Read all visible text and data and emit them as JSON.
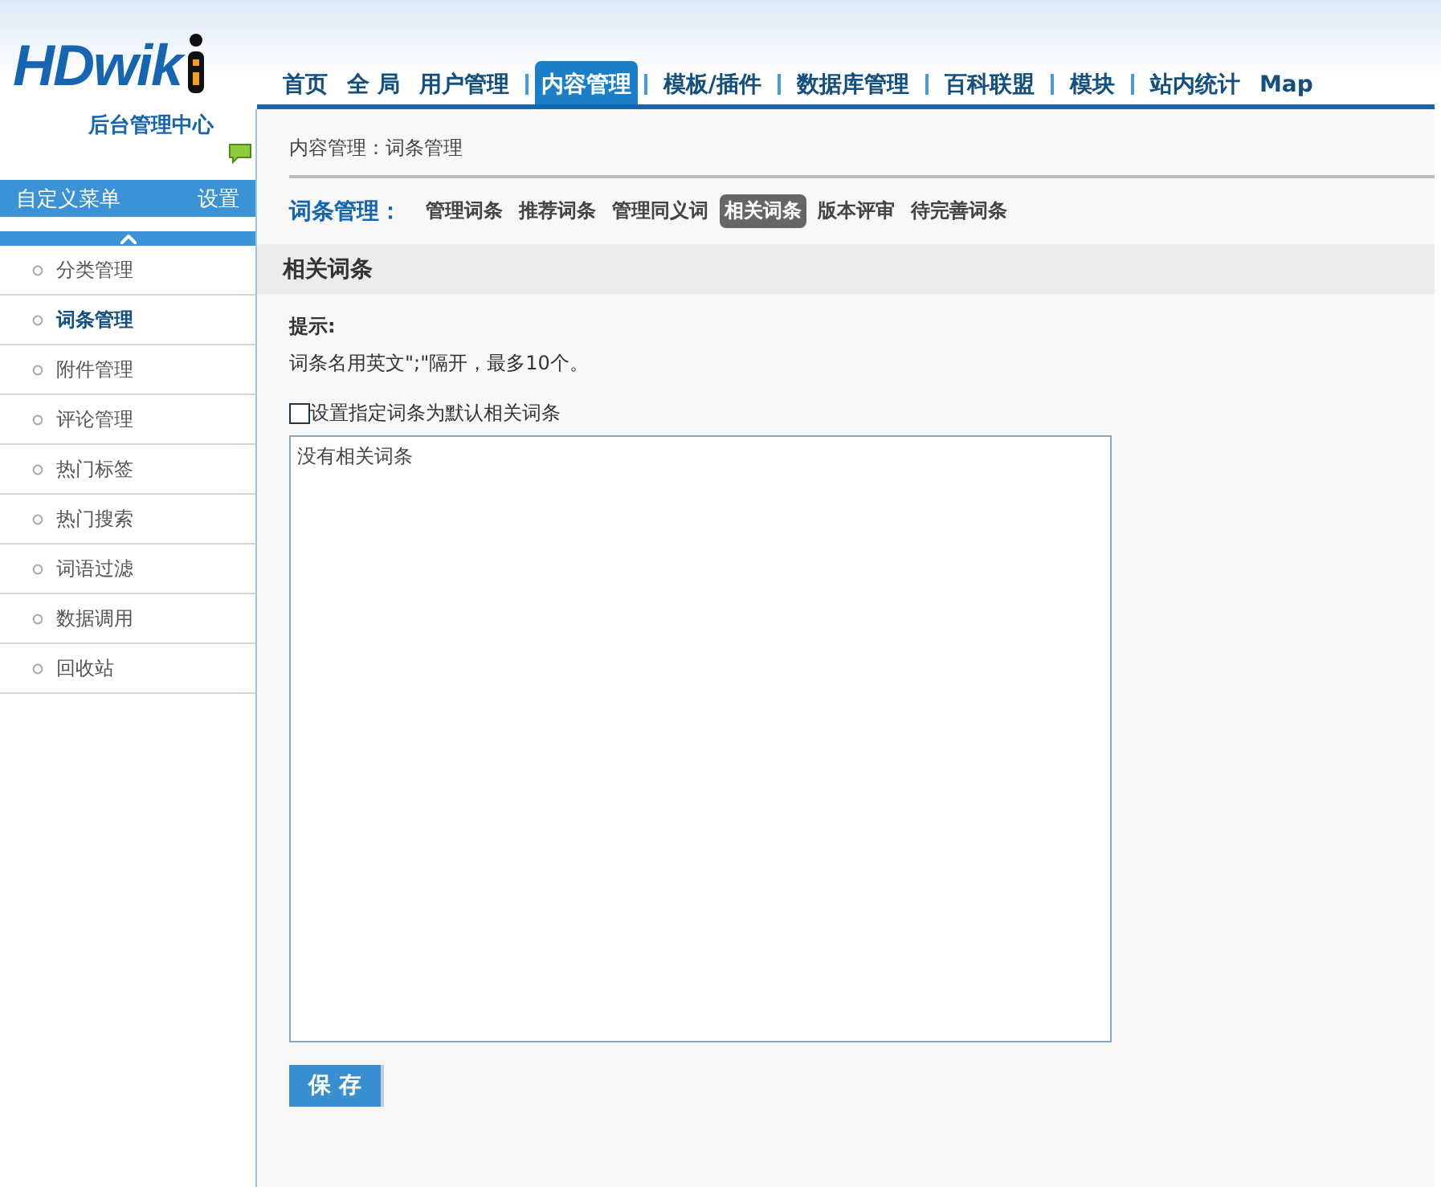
{
  "logo": {
    "wordmark": "HDwik",
    "subtitle": "后台管理中心"
  },
  "top_nav": [
    {
      "label": "首页",
      "selected": false,
      "divider": false
    },
    {
      "label": "全 局",
      "selected": false,
      "divider": false
    },
    {
      "label": "用户管理",
      "selected": false,
      "divider": false
    },
    {
      "label": "内容管理",
      "selected": true,
      "divider": true
    },
    {
      "label": "模板/插件",
      "selected": false,
      "divider": true
    },
    {
      "label": "数据库管理",
      "selected": false,
      "divider": true
    },
    {
      "label": "百科联盟",
      "selected": false,
      "divider": true
    },
    {
      "label": "模块",
      "selected": false,
      "divider": true
    },
    {
      "label": "站内统计",
      "selected": false,
      "divider": true
    },
    {
      "label": "Map",
      "selected": false,
      "divider": false
    }
  ],
  "sidebar": {
    "menu_title": "自定义菜单",
    "settings_link": "设置",
    "items": [
      {
        "label": "分类管理",
        "selected": false
      },
      {
        "label": "词条管理",
        "selected": true
      },
      {
        "label": "附件管理",
        "selected": false
      },
      {
        "label": "评论管理",
        "selected": false
      },
      {
        "label": "热门标签",
        "selected": false
      },
      {
        "label": "热门搜索",
        "selected": false
      },
      {
        "label": "词语过滤",
        "selected": false
      },
      {
        "label": "数据调用",
        "selected": false
      },
      {
        "label": "回收站",
        "selected": false
      }
    ]
  },
  "breadcrumb": "内容管理：词条管理",
  "sub_nav": {
    "title": "词条管理：",
    "tabs": [
      {
        "label": "管理词条",
        "selected": false
      },
      {
        "label": "推荐词条",
        "selected": false
      },
      {
        "label": "管理同义词",
        "selected": false
      },
      {
        "label": "相关词条",
        "selected": true
      },
      {
        "label": "版本评审",
        "selected": false
      },
      {
        "label": "待完善词条",
        "selected": false
      }
    ]
  },
  "section_title": "相关词条",
  "hint": {
    "label": "提示:",
    "text": "词条名用英文\";\"隔开，最多10个。"
  },
  "default_checkbox": {
    "label": "设置指定词条为默认相关词条",
    "checked": false
  },
  "related_textarea": {
    "value": "没有相关词条"
  },
  "save_button": "保 存"
}
